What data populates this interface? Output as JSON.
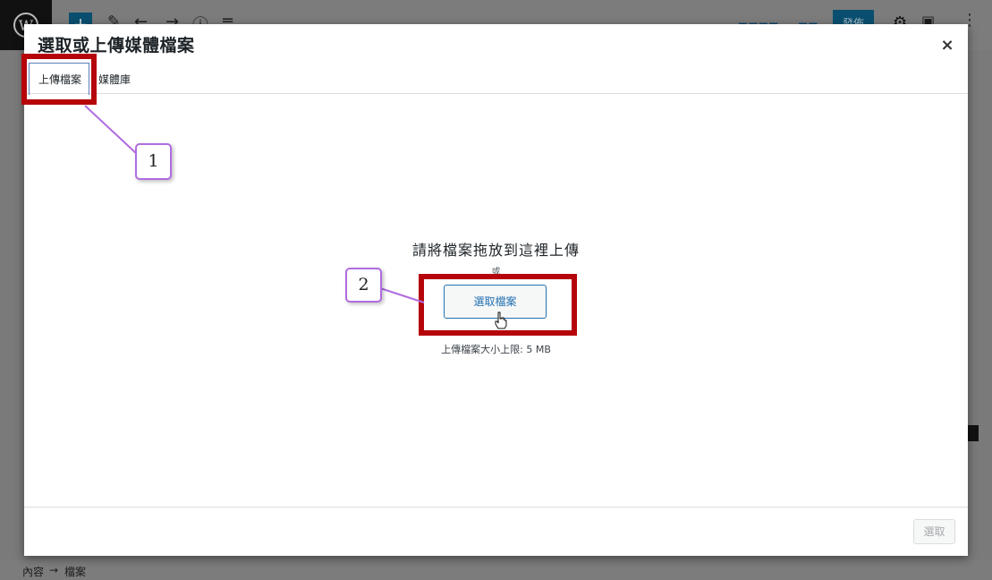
{
  "modal": {
    "title": "選取或上傳媒體檔案",
    "close_icon": "×"
  },
  "tabs": [
    {
      "label": "上傳檔案",
      "active": true
    },
    {
      "label": "媒體庫",
      "active": false
    }
  ],
  "upload": {
    "drop_text": "請將檔案拖放到這裡上傳",
    "or_text": "或",
    "select_button": "選取檔案",
    "max_size": "上傳檔案大小上限: 5 MB"
  },
  "footer": {
    "select_button": "選取"
  },
  "background": {
    "publish_label": "發佈",
    "breadcrumb_root": "內容",
    "breadcrumb_arrow": "→",
    "breadcrumb_current": "檔案"
  },
  "annotations": {
    "callout_1": "1",
    "callout_2": "2"
  },
  "colors": {
    "highlight": "#b5050b",
    "callout_border": "#b06ce0",
    "accent": "#2271b1"
  }
}
